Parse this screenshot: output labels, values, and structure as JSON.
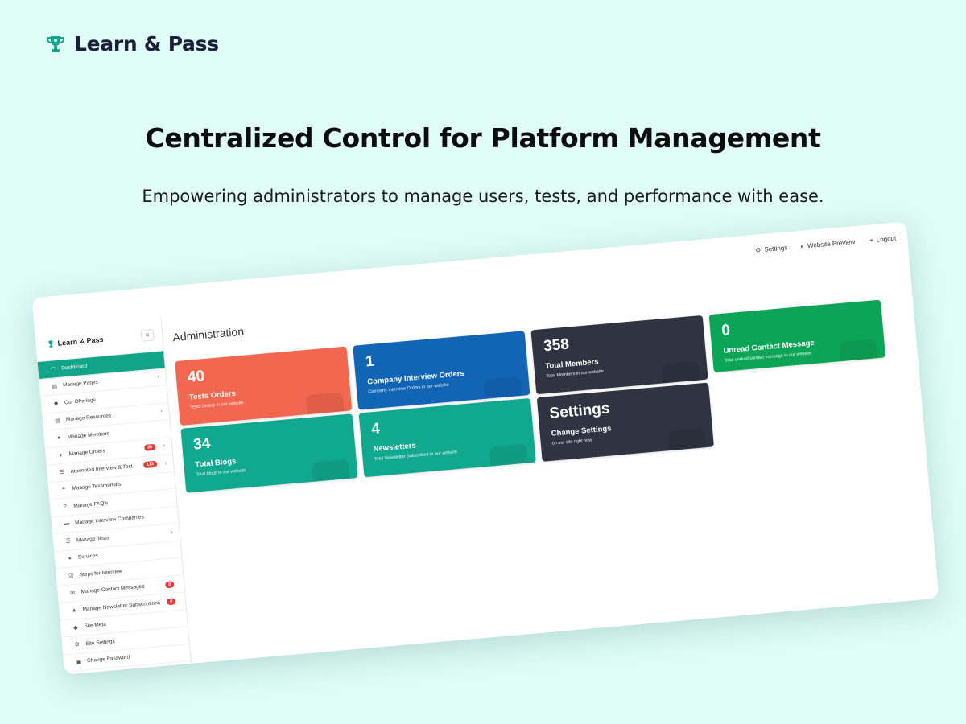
{
  "brand": {
    "name": "Learn & Pass",
    "icon": "trophy-icon",
    "color": "#12a589"
  },
  "headline": "Centralized Control for Platform Management",
  "subline": "Empowering administrators to manage users, tests, and performance with ease.",
  "dashboard": {
    "topbar": [
      {
        "label": "Settings",
        "icon": "gears-icon"
      },
      {
        "label": "Website Preview",
        "icon": "globe-icon"
      },
      {
        "label": "Logout",
        "icon": "logout-icon"
      }
    ],
    "sidebar_brand": "Learn & Pass",
    "nav": [
      {
        "label": "Dashboard",
        "icon": "gauge-icon",
        "active": true
      },
      {
        "label": "Manage Pages",
        "icon": "file-icon",
        "chevron": true
      },
      {
        "label": "Our Offerings",
        "icon": "tags-icon"
      },
      {
        "label": "Manage Resources",
        "icon": "file-icon",
        "chevron": true
      },
      {
        "label": "Manage Members",
        "icon": "users-icon"
      },
      {
        "label": "Manage Orders",
        "icon": "cart-icon",
        "badge": "35",
        "chevron": true
      },
      {
        "label": "Attempted Interview & Test",
        "icon": "list-icon",
        "badge": "113",
        "chevron": true
      },
      {
        "label": "Manage Testimonials",
        "icon": "quote-icon"
      },
      {
        "label": "Manage FAQ's",
        "icon": "question-icon"
      },
      {
        "label": "Manage Interview Companies",
        "icon": "briefcase-icon"
      },
      {
        "label": "Manage Tests",
        "icon": "list-icon",
        "chevron": true
      },
      {
        "label": "Services",
        "icon": "leaf-icon"
      },
      {
        "label": "Steps for Interview",
        "icon": "checkbox-icon"
      },
      {
        "label": "Manage Contact Messages",
        "icon": "envelope-icon",
        "badge": "0"
      },
      {
        "label": "Manage Newsletter Subscriptions",
        "icon": "bell-icon",
        "badge": "4"
      },
      {
        "label": "Site Meta",
        "icon": "tag-icon"
      },
      {
        "label": "Site Settings",
        "icon": "gears-icon"
      },
      {
        "label": "Change Password",
        "icon": "lock-icon"
      }
    ],
    "title": "Administration",
    "cards": [
      {
        "value": "40",
        "title": "Tests Orders",
        "desc": "Tests Orders in our website",
        "color": "#f2674f"
      },
      {
        "value": "34",
        "title": "Total Blogs",
        "desc": "Total blogs in our website.",
        "color": "#10a88f"
      },
      {
        "value": "1",
        "title": "Company Interview Orders",
        "desc": "Company Interview Orders in our website",
        "color": "#1264b5"
      },
      {
        "value": "4",
        "title": "Newsletters",
        "desc": "Total Newsletter Subscribed in our website.",
        "color": "#10a88f"
      },
      {
        "value": "358",
        "title": "Total Members",
        "desc": "Total Members in our website",
        "color": "#2f3342"
      },
      {
        "value": "Settings",
        "title": "Change Settings",
        "desc": "on our site right now.",
        "color": "#2f3342"
      },
      {
        "value": "0",
        "title": "Unread Contact Message",
        "desc": "Total unread contact message in our website.",
        "color": "#0ca557"
      }
    ]
  }
}
